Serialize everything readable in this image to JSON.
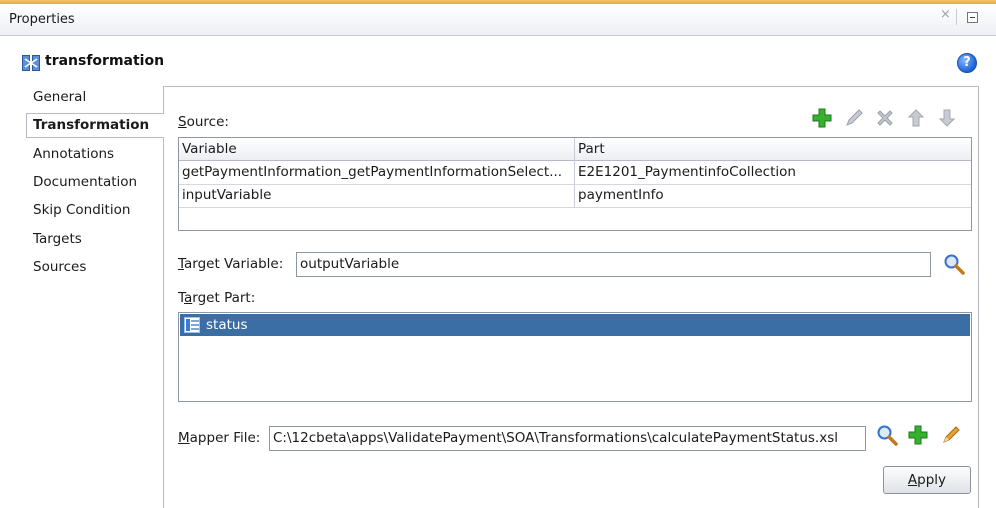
{
  "panel": {
    "title": "Properties",
    "close_glyph": "×"
  },
  "object": {
    "title": "transformation",
    "icon": "transformation-icon",
    "help_glyph": "?"
  },
  "nav": {
    "items": [
      {
        "label": "General",
        "selected": false
      },
      {
        "label": "Transformation",
        "selected": true
      },
      {
        "label": "Annotations",
        "selected": false
      },
      {
        "label": "Documentation",
        "selected": false
      },
      {
        "label": "Skip Condition",
        "selected": false
      },
      {
        "label": "Targets",
        "selected": false
      },
      {
        "label": "Sources",
        "selected": false
      }
    ]
  },
  "source": {
    "label_mnemonic": "S",
    "label_rest": "ource:",
    "columns": [
      "Variable",
      "Part"
    ],
    "rows": [
      {
        "variable": "getPaymentInformation_getPaymentInformationSelect...",
        "part": "E2E1201_PaymentinfoCollection"
      },
      {
        "variable": "inputVariable",
        "part": "paymentInfo"
      }
    ],
    "toolbar": [
      "add-icon",
      "edit-icon",
      "delete-icon",
      "move-up-icon",
      "move-down-icon"
    ]
  },
  "target_variable": {
    "label_mnemonic": "T",
    "label_rest": "arget Variable:",
    "value": "outputVariable"
  },
  "target_part": {
    "label_prefix": "T",
    "label_mnemonic": "a",
    "label_rest": "rget Part:",
    "items": [
      "status"
    ]
  },
  "mapper_file": {
    "label_mnemonic": "M",
    "label_rest": "apper File:",
    "value": "C:\\12cbeta\\apps\\ValidatePayment\\SOA\\Transformations\\calculatePaymentStatus.xsl"
  },
  "apply": {
    "label_mnemonic": "A",
    "label_rest": "pply"
  },
  "colors": {
    "accent_orange": "#e9a93c",
    "selection_blue": "#3a6ea5",
    "add_green": "#2fa32a"
  }
}
